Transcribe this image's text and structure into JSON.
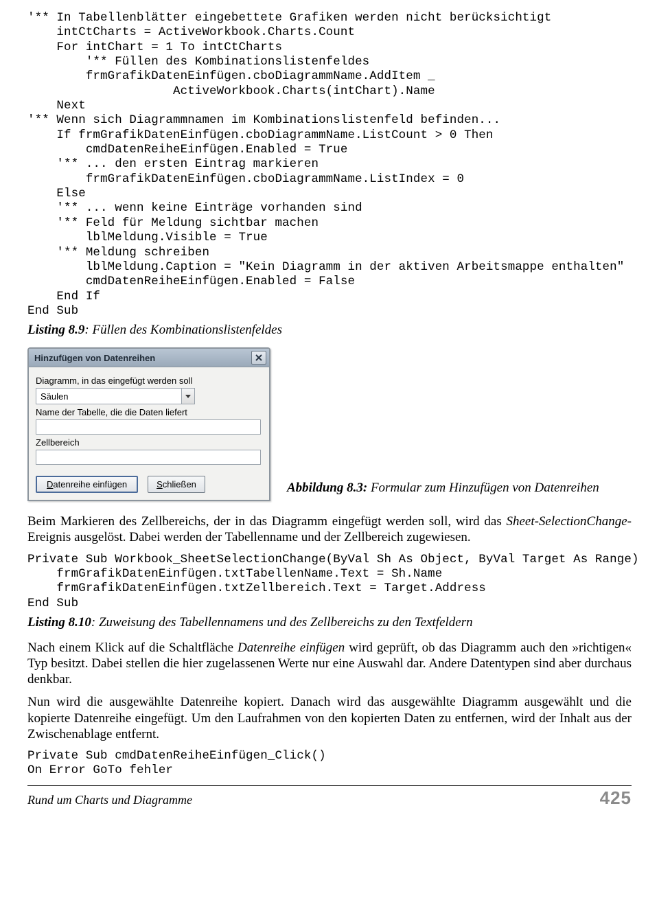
{
  "code1": "'** In Tabellenblätter eingebettete Grafiken werden nicht berücksichtigt\n    intCtCharts = ActiveWorkbook.Charts.Count\n    For intChart = 1 To intCtCharts\n        '** Füllen des Kombinationslistenfeldes\n        frmGrafikDatenEinfügen.cboDiagrammName.AddItem _\n                    ActiveWorkbook.Charts(intChart).Name\n    Next\n'** Wenn sich Diagrammnamen im Kombinationslistenfeld befinden...\n    If frmGrafikDatenEinfügen.cboDiagrammName.ListCount > 0 Then\n        cmdDatenReiheEinfügen.Enabled = True\n    '** ... den ersten Eintrag markieren\n        frmGrafikDatenEinfügen.cboDiagrammName.ListIndex = 0\n    Else\n    '** ... wenn keine Einträge vorhanden sind\n    '** Feld für Meldung sichtbar machen\n        lblMeldung.Visible = True\n    '** Meldung schreiben\n        lblMeldung.Caption = \"Kein Diagramm in der aktiven Arbeitsmappe enthalten\"\n        cmdDatenReiheEinfügen.Enabled = False\n    End If\nEnd Sub",
  "listing89_label": "Listing 8.9",
  "listing89_text": ": Füllen des Kombinationslistenfeldes",
  "dialog": {
    "title": "Hinzufügen von Datenreihen",
    "label1": "Diagramm, in das eingefügt werden soll",
    "combo_value": "Säulen",
    "label2": "Name der Tabelle, die die Daten liefert",
    "label3": "Zellbereich",
    "btn_insert_pre": "D",
    "btn_insert_rest": "atenreihe einfügen",
    "btn_close_pre": "S",
    "btn_close_rest": "chließen"
  },
  "fig_caption_label": "Abbildung 8.3:",
  "fig_caption_text": " Formular zum Hinzufügen von Datenreihen",
  "p1a": "Beim Markieren des Zellbereichs, der in das Diagramm eingefügt werden soll, wird das ",
  "p1_em1": "Sheet-SelectionChange",
  "p1b": "-Ereignis ausgelöst. Dabei werden der Tabellenname und der Zellbereich zugewiesen.",
  "code2": "Private Sub Workbook_SheetSelectionChange(ByVal Sh As Object, ByVal Target As Range)\n    frmGrafikDatenEinfügen.txtTabellenName.Text = Sh.Name\n    frmGrafikDatenEinfügen.txtZellbereich.Text = Target.Address\nEnd Sub",
  "listing810_label": "Listing 8.10",
  "listing810_text": ": Zuweisung des Tabellennamens und des Zellbereichs zu den Textfeldern",
  "p2a": "Nach einem Klick auf die Schaltfläche ",
  "p2_em1": "Datenreihe einfügen",
  "p2b": " wird geprüft, ob das Diagramm auch den »richtigen« Typ besitzt. Dabei stellen die hier zugelassenen Werte nur eine Auswahl dar. Andere Datentypen sind aber durchaus denkbar.",
  "p3": "Nun wird die ausgewählte Datenreihe kopiert. Danach wird das ausgewählte Diagramm ausgewählt und die kopierte Datenreihe eingefügt. Um den Laufrahmen von den kopierten Daten zu entfernen, wird der Inhalt aus der Zwischenablage entfernt.",
  "code3": "Private Sub cmdDatenReiheEinfügen_Click()\nOn Error GoTo fehler",
  "footer_text": "Rund um Charts und Diagramme",
  "footer_page": "425"
}
